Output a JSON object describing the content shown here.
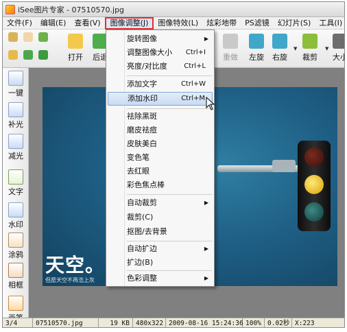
{
  "window": {
    "title": "iSee图片专家 - 07510570.jpg"
  },
  "menubar": [
    "文件(F)",
    "编辑(E)",
    "查看(V)",
    "图像调整(J)",
    "图像特效(L)",
    "炫彩地带",
    "PS滤镜",
    "幻灯片(S)",
    "工具(I)"
  ],
  "toolbar": {
    "open": "打开",
    "prev": "后退",
    "disabled": "重做",
    "rotate_left": "左旋",
    "rotate_right": "右旋",
    "crop": "裁剪",
    "size": "大小"
  },
  "leftbar": [
    "一键",
    "补光",
    "减光",
    "文字",
    "水印",
    "涂鸦",
    "相框",
    "画笔"
  ],
  "dropdown": {
    "items": [
      {
        "label": "旋转图像",
        "shortcut": "",
        "submenu": true
      },
      {
        "label": "调整图像大小",
        "shortcut": "Ctrl+I",
        "submenu": false
      },
      {
        "label": "亮度/对比度",
        "shortcut": "Ctrl+L",
        "submenu": false
      },
      {
        "label": "添加文字",
        "shortcut": "Ctrl+W",
        "submenu": false
      },
      {
        "label": "添加水印",
        "shortcut": "Ctrl+M",
        "submenu": false
      },
      {
        "label": "祛除黑斑",
        "shortcut": "",
        "submenu": false
      },
      {
        "label": "磨皮祛痘",
        "shortcut": "",
        "submenu": false
      },
      {
        "label": "皮肤美白",
        "shortcut": "",
        "submenu": false
      },
      {
        "label": "变色笔",
        "shortcut": "",
        "submenu": false
      },
      {
        "label": "去红眼",
        "shortcut": "",
        "submenu": false
      },
      {
        "label": "彩色焦点棒",
        "shortcut": "",
        "submenu": false
      },
      {
        "label": "自动裁剪",
        "shortcut": "",
        "submenu": true
      },
      {
        "label": "裁剪(C)",
        "shortcut": "",
        "submenu": false
      },
      {
        "label": "抠图/去背景",
        "shortcut": "",
        "submenu": false
      },
      {
        "label": "自动扩边",
        "shortcut": "",
        "submenu": true
      },
      {
        "label": "扩边(B)",
        "shortcut": "",
        "submenu": false
      },
      {
        "label": "色彩调整",
        "shortcut": "",
        "submenu": true
      }
    ],
    "arrow_glyph": "▶"
  },
  "photo": {
    "headline": "天空。",
    "caption": "但愿天空不再浩上灰"
  },
  "statusbar": [
    "3/4",
    "07510570.jpg",
    "19 KB",
    "480x322",
    "2009-08-16 15:24:36",
    "100%",
    "0.02秒",
    "X:223"
  ],
  "colors": {
    "highlight_border": "#e03030",
    "menu_highlight": "#c8daf3"
  }
}
